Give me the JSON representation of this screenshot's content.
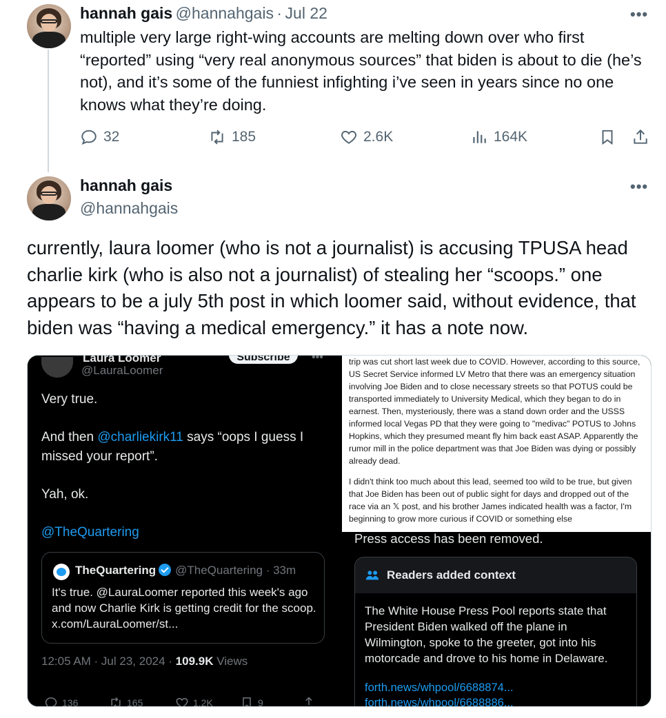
{
  "tweet1": {
    "author_name": "hannah gais",
    "handle": "@hannahgais",
    "separator": "·",
    "date": "Jul 22",
    "more": "•••",
    "text": "multiple very large right-wing accounts are melting down over who first “reported” using “very real anonymous sources” that biden is about to die (he’s not), and it’s some of the funniest infighting i’ve seen in years since no one knows what they’re doing.",
    "replies": "32",
    "reposts": "185",
    "likes": "2.6K",
    "views": "164K"
  },
  "tweet2": {
    "author_name": "hannah gais",
    "handle": "@hannahgais",
    "more": "•••",
    "text": "currently, laura loomer (who is not a journalist) is accusing TPUSA head charlie kirk (who is also not a journalist) of stealing her “scoops.” one appears to be a july 5th post in which loomer said, without evidence, that biden was “having a medical emergency.” it has a note now."
  },
  "left_screenshot": {
    "author_name": "Laura Loomer",
    "handle": "@LauraLoomer",
    "subscribe": "Subscribe",
    "dots": "•••",
    "line1": "Very true.",
    "line2_prefix": "And then ",
    "line2_mention": "@charliekirk11",
    "line2_suffix": " says “oops I guess I missed your report”.",
    "line3": "Yah, ok.",
    "line4_mention": "@TheQuartering",
    "quote": {
      "name": "TheQuartering",
      "handle": "@TheQuartering · 33m",
      "text": "It's true. @LauraLoomer reported this week's ago and now Charlie Kirk is getting credit for the scoop. x.com/LauraLoomer/st..."
    },
    "meta_time": "12:05 AM · Jul 23, 2024 · ",
    "meta_views_count": "109.9K",
    "meta_views_label": " Views",
    "replies": "136",
    "reposts": "165",
    "likes": "1.2K",
    "bookmarks": "9"
  },
  "right_screenshot": {
    "article_p1": "trip was cut short last week due to COVID. However, according to this source, US Secret Service informed LV Metro that there was an emergency situation involving Joe Biden and to close necessary streets so that POTUS could be transported immediately to University Medical, which they began to do in earnest. Then, mysteriously, there was a stand down order and the USSS informed local Vegas PD that they were going to \"medivac\" POTUS to Johns Hopkins, which they presumed meant fly him back east ASAP. Apparently the rumor mill in the police department was that Joe Biden was dying or possibly already dead.",
    "article_p2": "I didn't think too much about this lead, seemed too wild to be true, but given that Joe Biden has been out of public sight for days and dropped out of the race via an 𝕏 post, and his brother James indicated health was a factor, I'm beginning to grow more curious if COVID or something else",
    "press_removed": "Press access has been removed.",
    "note_header": "Readers added context",
    "note_text": "The White House Press Pool reports state that President Biden walked off the plane in Wilmington, spoke to the greeter, got into his motorcade and drove to his home in Delaware.",
    "note_link1": "forth.news/whpool/6688874...",
    "note_link2": "forth.news/whpool/6688886..."
  }
}
